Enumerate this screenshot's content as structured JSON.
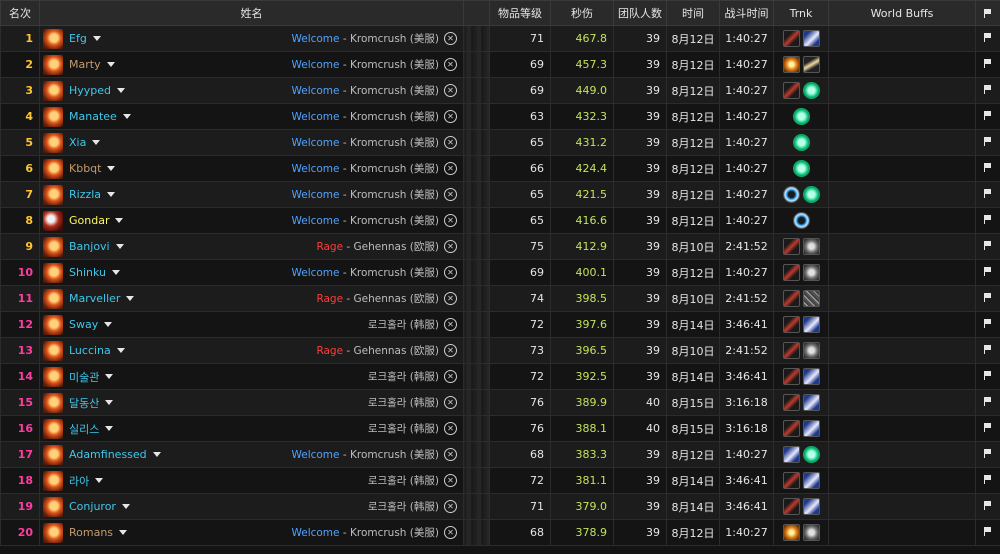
{
  "colors": {
    "rank_gold": "#ffc631",
    "rank_pink": "#ff3da1",
    "mage_blue": "#3fc7eb",
    "warrior_tan": "#c69b6d",
    "rogue_yellow": "#fff468",
    "dps_green": "#c4e35b",
    "guild_blue": "#4fa3ff",
    "guild_red": "#ff3b3b"
  },
  "header": {
    "rank": "名次",
    "name": "姓名",
    "ilvl": "物品等级",
    "dps": "秒伤",
    "raid_size": "团队人数",
    "date": "时间",
    "duration": "战斗时间",
    "trinkets": "Trnk",
    "world_buffs": "World Buffs"
  },
  "rows": [
    {
      "rank": "1",
      "name": "Efg",
      "cls": "mage",
      "spec": "fire",
      "guild_name": "Welcome",
      "guild_type": "blue",
      "server": "Kromcrush (美服)",
      "ilvl": "71",
      "dps": "467.8",
      "raid": "39",
      "date": "8月12日",
      "duration": "1:40:27",
      "trinkets": [
        "blade",
        "moon"
      ]
    },
    {
      "rank": "2",
      "name": "Marty",
      "cls": "warrior",
      "spec": "fire",
      "guild_name": "Welcome",
      "guild_type": "blue",
      "server": "Kromcrush (美服)",
      "ilvl": "69",
      "dps": "457.3",
      "raid": "39",
      "date": "8月12日",
      "duration": "1:40:27",
      "trinkets": [
        "glove",
        "feather"
      ]
    },
    {
      "rank": "3",
      "name": "Hyyped",
      "cls": "mage",
      "spec": "fire",
      "guild_name": "Welcome",
      "guild_type": "blue",
      "server": "Kromcrush (美服)",
      "ilvl": "69",
      "dps": "449.0",
      "raid": "39",
      "date": "8月12日",
      "duration": "1:40:27",
      "trinkets": [
        "blade",
        "orb"
      ]
    },
    {
      "rank": "4",
      "name": "Manatee",
      "cls": "mage",
      "spec": "fire",
      "guild_name": "Welcome",
      "guild_type": "blue",
      "server": "Kromcrush (美服)",
      "ilvl": "63",
      "dps": "432.3",
      "raid": "39",
      "date": "8月12日",
      "duration": "1:40:27",
      "trinkets": [
        "orb"
      ]
    },
    {
      "rank": "5",
      "name": "Xia",
      "cls": "mage",
      "spec": "fire",
      "guild_name": "Welcome",
      "guild_type": "blue",
      "server": "Kromcrush (美服)",
      "ilvl": "65",
      "dps": "431.2",
      "raid": "39",
      "date": "8月12日",
      "duration": "1:40:27",
      "trinkets": [
        "orb"
      ]
    },
    {
      "rank": "6",
      "name": "Kbbqt",
      "cls": "warrior",
      "spec": "fire",
      "guild_name": "Welcome",
      "guild_type": "blue",
      "server": "Kromcrush (美服)",
      "ilvl": "66",
      "dps": "424.4",
      "raid": "39",
      "date": "8月12日",
      "duration": "1:40:27",
      "trinkets": [
        "orb"
      ]
    },
    {
      "rank": "7",
      "name": "Rizzla",
      "cls": "mage",
      "spec": "fire",
      "guild_name": "Welcome",
      "guild_type": "blue",
      "server": "Kromcrush (美服)",
      "ilvl": "65",
      "dps": "421.5",
      "raid": "39",
      "date": "8月12日",
      "duration": "1:40:27",
      "trinkets": [
        "ring",
        "orb"
      ]
    },
    {
      "rank": "8",
      "name": "Gondar",
      "cls": "rogue",
      "spec": "sword",
      "guild_name": "Welcome",
      "guild_type": "blue",
      "server": "Kromcrush (美服)",
      "ilvl": "65",
      "dps": "416.6",
      "raid": "39",
      "date": "8月12日",
      "duration": "1:40:27",
      "trinkets": [
        "ring"
      ]
    },
    {
      "rank": "9",
      "name": "Banjovi",
      "cls": "mage",
      "spec": "fire",
      "guild_name": "Rage",
      "guild_type": "red",
      "server": "Gehennas (欧服)",
      "ilvl": "75",
      "dps": "412.9",
      "raid": "39",
      "date": "8月10日",
      "duration": "2:41:52",
      "trinkets": [
        "blade",
        "gear"
      ]
    },
    {
      "rank": "10",
      "name": "Shinku",
      "cls": "mage",
      "spec": "fire",
      "guild_name": "Welcome",
      "guild_type": "blue",
      "server": "Kromcrush (美服)",
      "ilvl": "69",
      "dps": "400.1",
      "raid": "39",
      "date": "8月12日",
      "duration": "1:40:27",
      "trinkets": [
        "blade",
        "gear"
      ]
    },
    {
      "rank": "11",
      "name": "Marveller",
      "cls": "mage",
      "spec": "fire",
      "guild_name": "Rage",
      "guild_type": "red",
      "server": "Gehennas (欧服)",
      "ilvl": "74",
      "dps": "398.5",
      "raid": "39",
      "date": "8月10日",
      "duration": "2:41:52",
      "trinkets": [
        "blade",
        "web"
      ]
    },
    {
      "rank": "12",
      "name": "Sway",
      "cls": "mage",
      "spec": "fire",
      "guild_name": "",
      "guild_type": "none",
      "server": "로크홀라 (韩服)",
      "ilvl": "72",
      "dps": "397.6",
      "raid": "39",
      "date": "8月14日",
      "duration": "3:46:41",
      "trinkets": [
        "blade",
        "moon"
      ]
    },
    {
      "rank": "13",
      "name": "Luccina",
      "cls": "mage",
      "spec": "fire",
      "guild_name": "Rage",
      "guild_type": "red",
      "server": "Gehennas (欧服)",
      "ilvl": "73",
      "dps": "396.5",
      "raid": "39",
      "date": "8月10日",
      "duration": "2:41:52",
      "trinkets": [
        "blade",
        "gear"
      ]
    },
    {
      "rank": "14",
      "name": "미술관",
      "cls": "mage",
      "spec": "fire",
      "guild_name": "",
      "guild_type": "none",
      "server": "로크홀라 (韩服)",
      "ilvl": "72",
      "dps": "392.5",
      "raid": "39",
      "date": "8月14日",
      "duration": "3:46:41",
      "trinkets": [
        "blade",
        "moon"
      ]
    },
    {
      "rank": "15",
      "name": "달동산",
      "cls": "mage",
      "spec": "fire",
      "guild_name": "",
      "guild_type": "none",
      "server": "로크홀라 (韩服)",
      "ilvl": "76",
      "dps": "389.9",
      "raid": "40",
      "date": "8月15日",
      "duration": "3:16:18",
      "trinkets": [
        "blade",
        "moon"
      ]
    },
    {
      "rank": "16",
      "name": "실리스",
      "cls": "mage",
      "spec": "fire",
      "guild_name": "",
      "guild_type": "none",
      "server": "로크홀라 (韩服)",
      "ilvl": "76",
      "dps": "388.1",
      "raid": "40",
      "date": "8月15日",
      "duration": "3:16:18",
      "trinkets": [
        "blade",
        "moon"
      ]
    },
    {
      "rank": "17",
      "name": "Adamfinessed",
      "cls": "mage",
      "spec": "fire",
      "guild_name": "Welcome",
      "guild_type": "blue",
      "server": "Kromcrush (美服)",
      "ilvl": "68",
      "dps": "383.3",
      "raid": "39",
      "date": "8月12日",
      "duration": "1:40:27",
      "trinkets": [
        "moon",
        "orb"
      ]
    },
    {
      "rank": "18",
      "name": "라아",
      "cls": "mage",
      "spec": "fire",
      "guild_name": "",
      "guild_type": "none",
      "server": "로크홀라 (韩服)",
      "ilvl": "72",
      "dps": "381.1",
      "raid": "39",
      "date": "8月14日",
      "duration": "3:46:41",
      "trinkets": [
        "blade",
        "moon"
      ]
    },
    {
      "rank": "19",
      "name": "Conjuror",
      "cls": "mage",
      "spec": "fire",
      "guild_name": "",
      "guild_type": "none",
      "server": "로크홀라 (韩服)",
      "ilvl": "71",
      "dps": "379.0",
      "raid": "39",
      "date": "8月14日",
      "duration": "3:46:41",
      "trinkets": [
        "blade",
        "moon"
      ]
    },
    {
      "rank": "20",
      "name": "Romans",
      "cls": "warrior",
      "spec": "fire",
      "guild_name": "Welcome",
      "guild_type": "blue",
      "server": "Kromcrush (美服)",
      "ilvl": "68",
      "dps": "378.9",
      "raid": "39",
      "date": "8月12日",
      "duration": "1:40:27",
      "trinkets": [
        "glove",
        "gear"
      ]
    }
  ]
}
